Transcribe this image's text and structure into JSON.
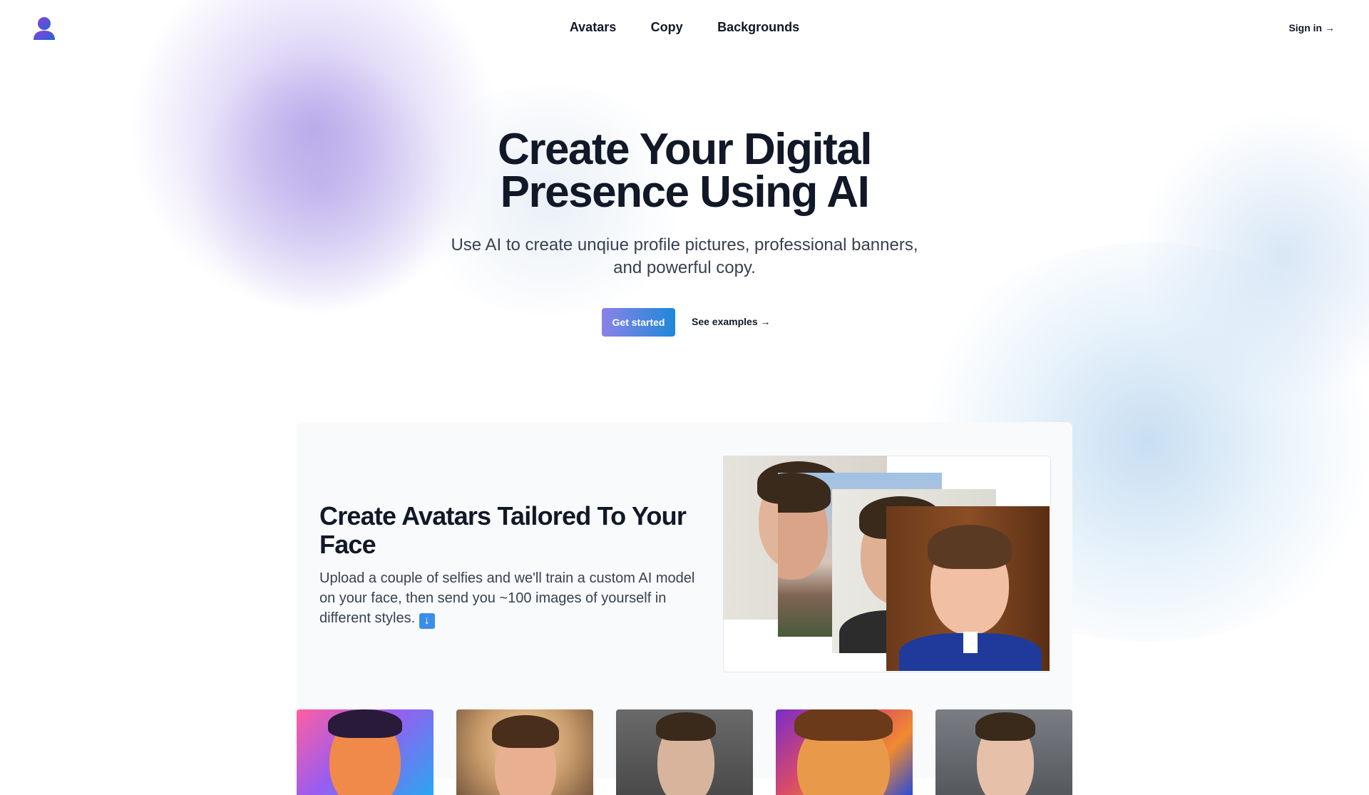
{
  "header": {
    "logo_icon": "user-avatar-icon",
    "nav": [
      "Avatars",
      "Copy",
      "Backgrounds"
    ],
    "sign_in": "Sign in →"
  },
  "hero": {
    "title_line1": "Create Your Digital",
    "title_line2": "Presence Using AI",
    "subtitle_line1": "Use AI to create unqiue profile pictures, professional banners,",
    "subtitle_line2": "and powerful copy.",
    "cta_primary": "Get started",
    "cta_secondary": "See examples →"
  },
  "feature": {
    "title_line1": "Create Avatars Tailored To Your",
    "title_line2": "Face",
    "desc_line1": "Upload a couple of selfies and we'll train a custom AI model",
    "desc_line2": "on your face, then send you ~100 images of yourself in",
    "desc_line3": "different styles.",
    "desc_emoji": "⬇️"
  },
  "colors": {
    "accent_gradient_start": "#8b82e8",
    "accent_gradient_end": "#1e88d8",
    "text_primary": "#111827",
    "text_secondary": "#374151",
    "card_bg": "#f9fafb"
  }
}
